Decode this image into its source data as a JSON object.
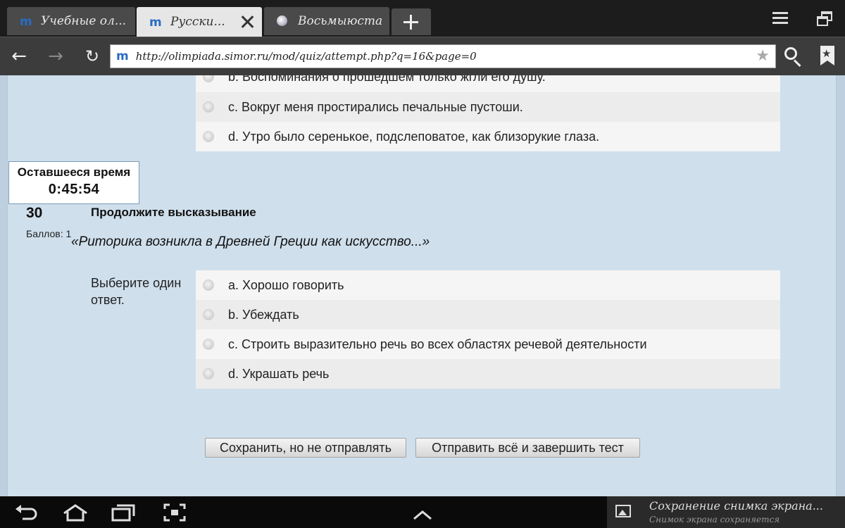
{
  "browser": {
    "tabs": [
      {
        "title": "Учебные ол...",
        "icon": "moodle-m-icon",
        "active": false
      },
      {
        "title": "Русски...",
        "icon": "moodle-m-icon",
        "active": true
      },
      {
        "title": "Восьмыюста...",
        "icon": "globe-icon",
        "active": false
      }
    ],
    "url": "http://olimpiada.simor.ru/mod/quiz/attempt.php?q=16&page=0"
  },
  "previous_question": {
    "answers": [
      {
        "text": "b. Воспоминания о прошедшем только жгли его душу."
      },
      {
        "text": "c. Вокруг меня простирались печальные пустоши."
      },
      {
        "text": "d. Утро было серенькое, подслеповатое, как близорукие глаза."
      }
    ]
  },
  "timer": {
    "label": "Оставшееся время",
    "value": "0:45:54"
  },
  "question": {
    "number": "30",
    "marks": "Баллов: 1",
    "title": "Продолжите высказывание",
    "text": "«Риторика возникла в Древней Греции как искусство...»",
    "prompt": "Выберите один ответ.",
    "answers": [
      {
        "text": "a. Хорошо говорить"
      },
      {
        "text": "b. Убеждать"
      },
      {
        "text": "c. Строить выразительно речь во всех областях речевой деятельности"
      },
      {
        "text": "d. Украшать речь"
      }
    ]
  },
  "buttons": {
    "save": "Сохранить, но не отправлять",
    "submit": "Отправить всё и завершить тест"
  },
  "notification": {
    "title": "Сохранение снимка экрана...",
    "subtitle": "Снимок экрана сохраняется"
  },
  "colors": {
    "page_background": "#cfdfec",
    "tabstrip": "#1c1c1c",
    "toolbar": "#3c3c3c",
    "moodle_icon": "#2a6cc4"
  }
}
